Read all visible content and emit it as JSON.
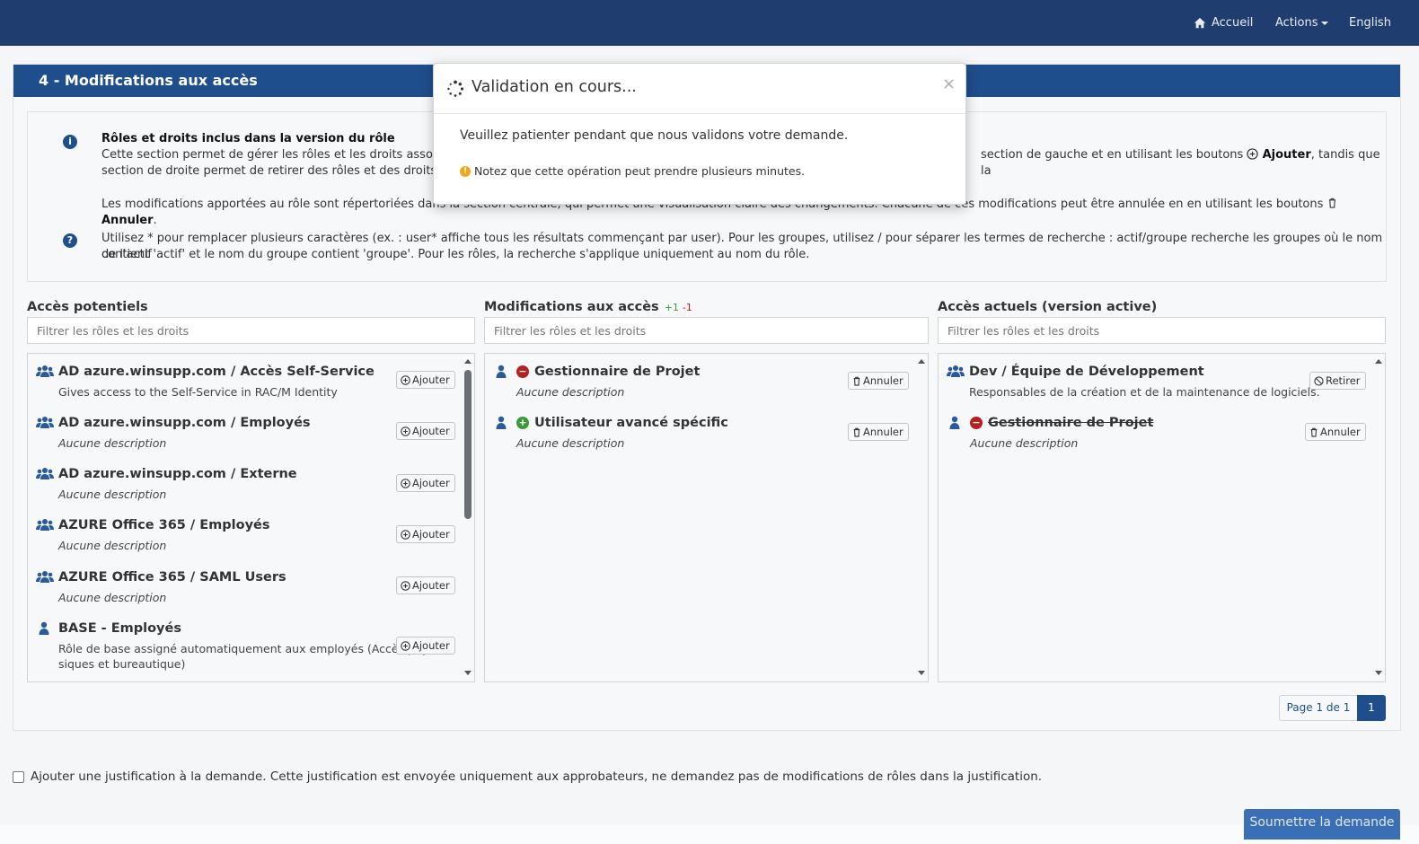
{
  "nav": {
    "home_label": "Accueil",
    "actions_label": "Actions",
    "language_label": "English"
  },
  "panel": {
    "title": "4 - Modifications aux accès"
  },
  "info": {
    "heading": "Rôles et droits inclus dans la version du rôle",
    "line1_a": "Cette section permet de gérer les rôles et les droits associés à un",
    "line1_b": "section de gauche et en utilisant les boutons",
    "line1_add": "Ajouter",
    "line1_c": ", tandis que la",
    "line2": "section de droite permet de retirer des rôles et des droits exista",
    "line3_a": "Les modifications apportées au rôle sont répertoriées dans la section centrale, qui permet une visualisation claire des changements. Chacune de ces modifications peut être annulée en en utilisant les boutons",
    "line3_cancel": "Annuler",
    "line3_end": ".",
    "help_line1": "Utilisez * pour remplacer plusieurs caractères (ex. : user* affiche tous les résultats commençant par user). Pour les groupes, utilisez / pour séparer les termes de recherche : actif/groupe recherche les groupes où le nom de l'actif",
    "help_line2": "contient 'actif' et le nom du groupe contient 'groupe'. Pour les rôles, la recherche s'applique uniquement au nom du rôle."
  },
  "columns": {
    "potential": {
      "title": "Accès potentiels",
      "filter_placeholder": "Filtrer les rôles et les droits",
      "items": [
        {
          "name": "AD azure.winsupp.com / Accès Self-Service",
          "desc": "Gives access to the Self-Service in RAC/M Identity",
          "button": "Ajouter"
        },
        {
          "name": "AD azure.winsupp.com / Employés",
          "desc": "Aucune description",
          "button": "Ajouter"
        },
        {
          "name": "AD azure.winsupp.com / Externe",
          "desc": "Aucune description",
          "button": "Ajouter"
        },
        {
          "name": "AZURE Office 365 / Employés",
          "desc": "Aucune description",
          "button": "Ajouter"
        },
        {
          "name": "AZURE Office 365 / SAML Users",
          "desc": "Aucune description",
          "button": "Ajouter"
        },
        {
          "name": "BASE - Employés",
          "desc1": "Rôle de base assigné automatiquement aux employés (Accès phy",
          "desc2": "siques et bureautique)",
          "button": "Ajouter"
        }
      ]
    },
    "changes": {
      "title": "Modifications aux accès",
      "plus": "+1",
      "minus": "-1",
      "filter_placeholder": "Filtrer les rôles et les droits",
      "items": [
        {
          "name": "Gestionnaire de Projet",
          "desc": "Aucune description",
          "button": "Annuler",
          "kind": "remove"
        },
        {
          "name": "Utilisateur avancé spécific",
          "desc": "Aucune description",
          "button": "Annuler",
          "kind": "add"
        }
      ]
    },
    "current": {
      "title": "Accès actuels (version active)",
      "filter_placeholder": "Filtrer les rôles et les droits",
      "items": [
        {
          "name": "Dev / Équipe de Développement",
          "desc": "Responsables de la création et de la maintenance de logiciels.",
          "button": "Retirer"
        },
        {
          "name": "Gestionnaire de Projet",
          "desc": "Aucune description",
          "button": "Annuler"
        }
      ]
    }
  },
  "pagination": {
    "summary": "Page 1 de 1",
    "current_page": "1"
  },
  "justification": {
    "label": "Ajouter une justification à la demande. Cette justification est envoyée uniquement aux approbateurs, ne demandez pas de modifications de rôles dans la justification."
  },
  "submit_label": "Soumettre la demande",
  "modal": {
    "title": "Validation en cours...",
    "close": "×",
    "body": "Veuillez patienter pendant que nous validons votre demande.",
    "note": "Notez que cette opération peut prendre plusieurs minutes."
  },
  "colors": {
    "topbar": "#1f3d6e",
    "panel_header": "#1f4e8c",
    "add_green": "#3a9a3a",
    "remove_red": "#b52020",
    "icon_blue": "#2a5a9c",
    "warning": "#f0a818"
  }
}
